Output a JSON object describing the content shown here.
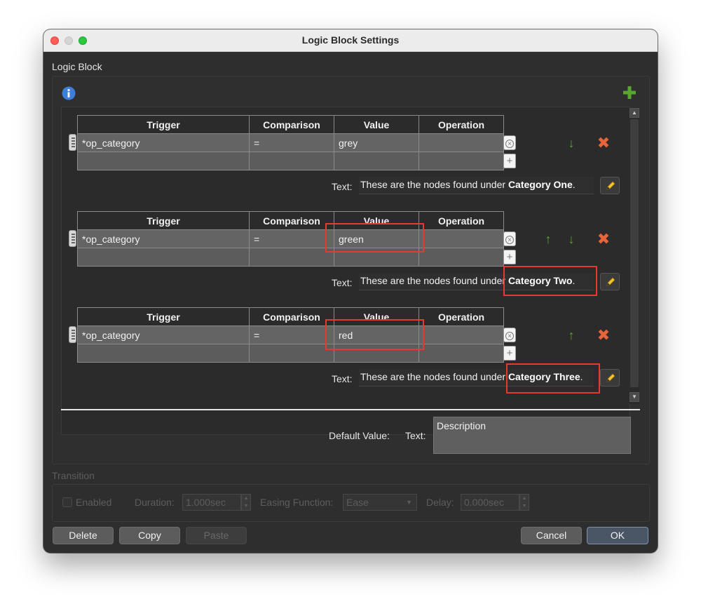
{
  "window": {
    "title": "Logic Block Settings"
  },
  "logic_block": {
    "label": "Logic Block",
    "headers": {
      "trigger": "Trigger",
      "comparison": "Comparison",
      "value": "Value",
      "operation": "Operation"
    },
    "text_label": "Text:",
    "text_prefix": "These are the nodes found under",
    "blocks": [
      {
        "trigger": "*op_category",
        "comparison": "=",
        "value": "grey",
        "operation": "",
        "text_bold": "Category One",
        "text_suffix": "."
      },
      {
        "trigger": "*op_category",
        "comparison": "=",
        "value": "green",
        "operation": "",
        "text_bold": "Category Two",
        "text_suffix": "."
      },
      {
        "trigger": "*op_category",
        "comparison": "=",
        "value": "red",
        "operation": "",
        "text_bold": "Category Three",
        "text_suffix": "."
      }
    ],
    "default_value_label": "Default Value:",
    "default_text_label": "Text:",
    "default_text_value": "Description"
  },
  "icons": {
    "info": "info-icon",
    "add": "plus-icon",
    "up": "arrow-up-icon",
    "down": "arrow-down-icon",
    "remove": "x-icon",
    "edit": "pencil-icon"
  },
  "colors": {
    "accent_green": "#58a82f",
    "remove_orange": "#e8643a",
    "info_blue": "#3f7fdc",
    "highlight_red": "#e43a2f"
  },
  "transition": {
    "label": "Transition",
    "enabled_label": "Enabled",
    "duration_label": "Duration:",
    "duration_value": "1.000sec",
    "easing_label": "Easing Function:",
    "easing_value": "Ease",
    "delay_label": "Delay:",
    "delay_value": "0.000sec"
  },
  "buttons": {
    "delete": "Delete",
    "copy": "Copy",
    "paste": "Paste",
    "cancel": "Cancel",
    "ok": "OK"
  }
}
